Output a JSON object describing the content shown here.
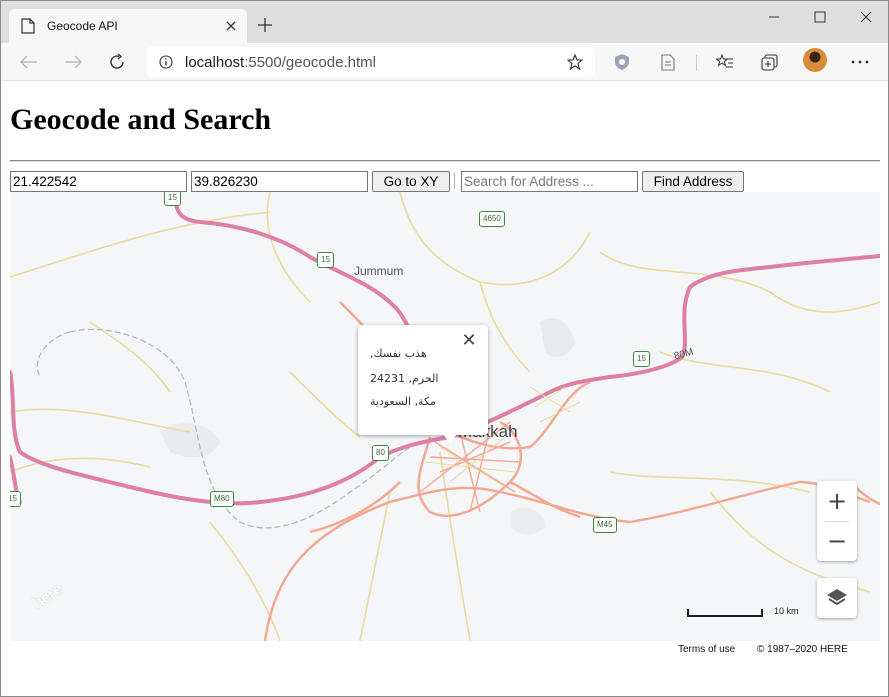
{
  "browser": {
    "tab_title": "Geocode API",
    "url_host": "localhost",
    "url_rest": ":5500/geocode.html"
  },
  "page": {
    "title": "Geocode and Search",
    "lat_value": "21.422542",
    "lon_value": "39.826230",
    "goto_label": "Go to XY",
    "search_placeholder": "Search for Address ...",
    "find_label": "Find Address"
  },
  "map": {
    "popup": {
      "line1": "هذب نفسك,",
      "line2": "الحرم, 24231",
      "line3": "مكة, السعودية"
    },
    "city_label": "Makkah",
    "town_label": "Jummum",
    "road_label_80m": "80M",
    "shields": [
      "15",
      "4650",
      "15",
      "15",
      "80",
      "M45",
      "M80",
      "15"
    ],
    "scale_label": "10 km",
    "terms_label": "Terms of use",
    "copyright_label": "© 1987–2020 HERE",
    "logo_text": "here",
    "zoom_in_label": "+",
    "zoom_out_label": "−"
  },
  "colors": {
    "highway": "#df7fa6",
    "primary_road": "#f3a691",
    "minor_road": "#eadb9e",
    "map_bg": "#f4f6f8"
  },
  "icons": [
    "page-icon",
    "close-icon",
    "plus-icon",
    "minimize-icon",
    "maximize-icon",
    "window-close-icon",
    "back-icon",
    "forward-icon",
    "refresh-icon",
    "info-icon",
    "star-icon",
    "shield-extension-icon",
    "reading-icon",
    "favorites-icon",
    "collections-icon",
    "more-icon",
    "layers-icon"
  ]
}
